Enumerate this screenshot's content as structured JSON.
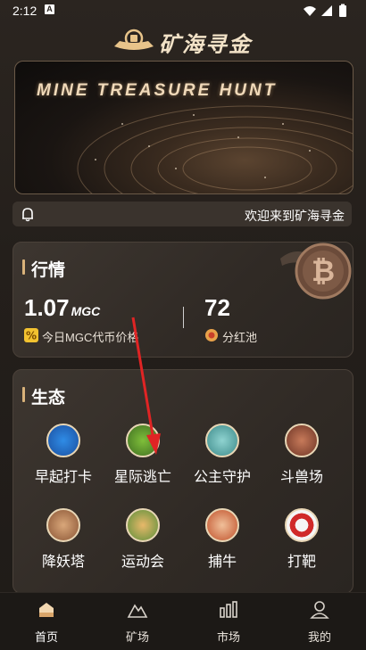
{
  "status_bar": {
    "time": "2:12",
    "badge": "A"
  },
  "header": {
    "title": "矿海寻金",
    "logo_icon": "gold-ingot-logo-icon"
  },
  "banner": {
    "title": "MINE TREASURE HUNT"
  },
  "notice": {
    "text": "欢迎来到矿海寻金",
    "icon": "bell-icon"
  },
  "market": {
    "title": "行情",
    "price_value": "1.07",
    "price_unit": "MGC",
    "price_label": "今日MGC代币价格",
    "pool_value": "72",
    "pool_label": "分红池",
    "coin_icon": "bitcoin-coin-icon"
  },
  "ecology": {
    "title": "生态",
    "items": [
      {
        "label": "早起打卡"
      },
      {
        "label": "星际逃亡"
      },
      {
        "label": "公主守护"
      },
      {
        "label": "斗兽场"
      },
      {
        "label": "降妖塔"
      },
      {
        "label": "运动会"
      },
      {
        "label": "捕牛"
      },
      {
        "label": "打靶"
      }
    ]
  },
  "tabbar": {
    "tabs": [
      {
        "label": "首页",
        "active": true
      },
      {
        "label": "矿场"
      },
      {
        "label": "市场"
      },
      {
        "label": "我的"
      }
    ]
  },
  "colors": {
    "accent": "#d9b27a",
    "background": "#241f1b",
    "arrow": "#e02424"
  }
}
